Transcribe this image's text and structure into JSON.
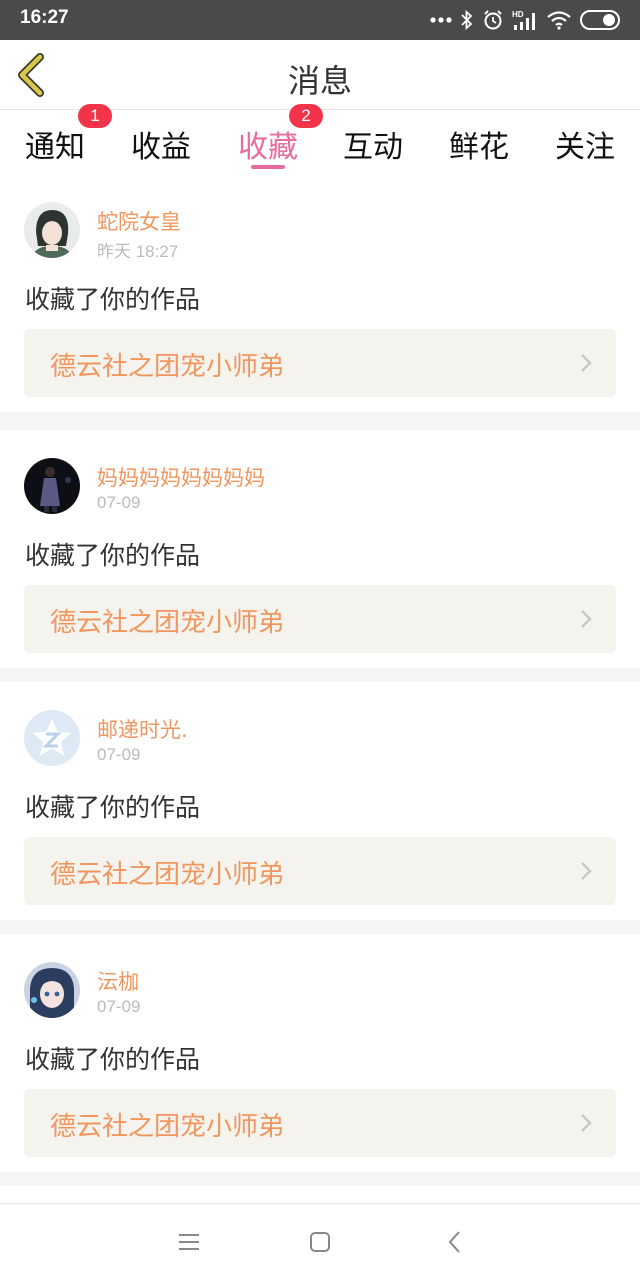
{
  "status_bar": {
    "time": "16:27",
    "icons": [
      "more-dots-icon",
      "bluetooth-icon",
      "alarm-icon",
      "hd-signal-icon",
      "wifi-icon",
      "battery-icon"
    ]
  },
  "header": {
    "title": "消息",
    "back_icon": "chevron-left-icon",
    "accent_color": "#d8c94a"
  },
  "tabs": [
    {
      "label": "通知",
      "badge": "1",
      "active": false
    },
    {
      "label": "收益",
      "badge": "",
      "active": false
    },
    {
      "label": "收藏",
      "badge": "2",
      "active": true
    },
    {
      "label": "互动",
      "badge": "",
      "active": false
    },
    {
      "label": "鲜花",
      "badge": "",
      "active": false
    },
    {
      "label": "关注",
      "badge": "",
      "active": false
    }
  ],
  "colors": {
    "active_tab": "#e96c9e",
    "badge": "#f2334a",
    "username": "#f0965e",
    "work_title": "#f0965e"
  },
  "messages": [
    {
      "user": "蛇院女皇",
      "time": "昨天 18:27",
      "action": "收藏了你的作品",
      "work": "德云社之团宠小师弟",
      "avatar": "anime-avatar"
    },
    {
      "user": "妈妈妈妈妈妈妈妈",
      "time": "07-09",
      "action": "收藏了你的作品",
      "work": "德云社之团宠小师弟",
      "avatar": "performer-avatar"
    },
    {
      "user": "邮递时光.",
      "time": "07-09",
      "action": "收藏了你的作品",
      "work": "德云社之团宠小师弟",
      "avatar": "qzone-default-avatar"
    },
    {
      "user": "沄枷",
      "time": "07-09",
      "action": "收藏了你的作品",
      "work": "德云社之团宠小师弟",
      "avatar": "anime-girl-avatar"
    }
  ],
  "nav_bar": {
    "icons": [
      "menu-icon",
      "home-square-icon",
      "back-triangle-icon"
    ]
  }
}
